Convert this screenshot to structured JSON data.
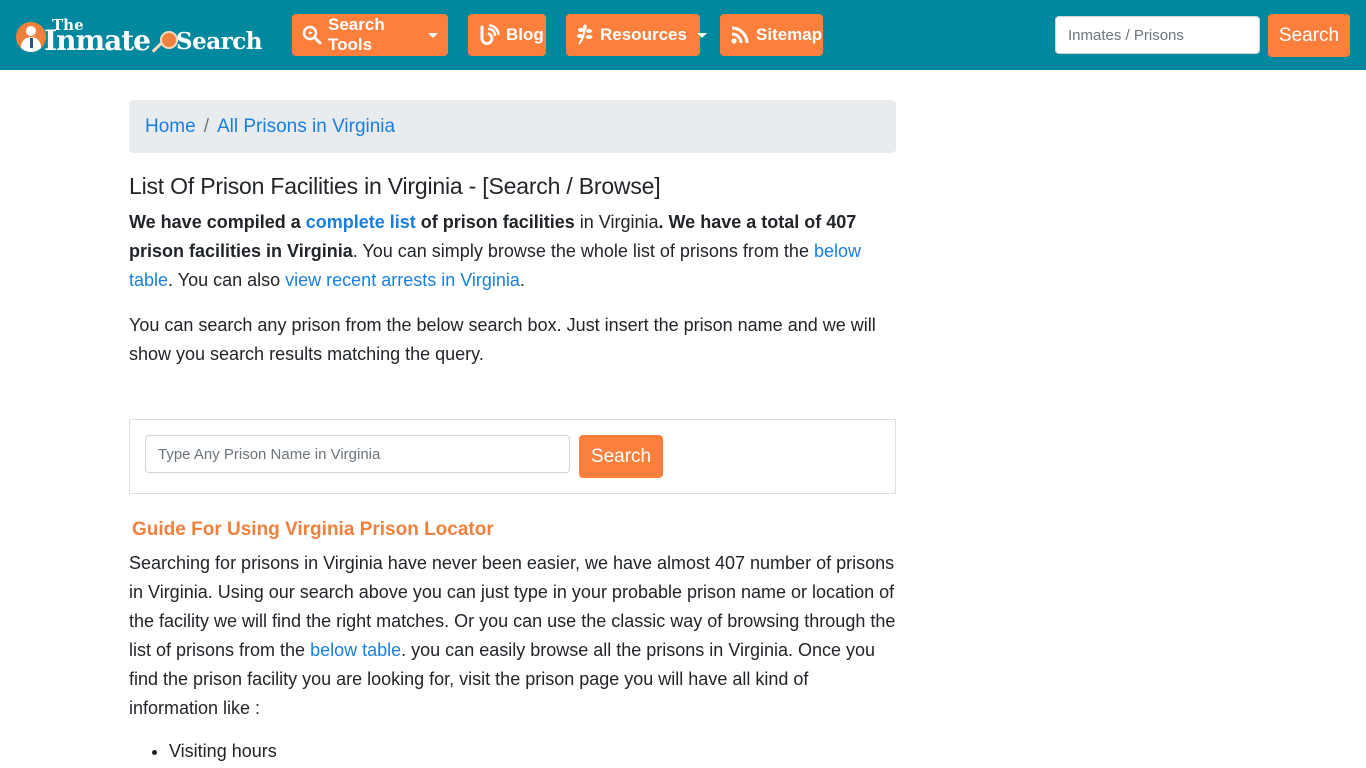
{
  "navbar": {
    "logo": {
      "the": "The",
      "inmate": "Inmate",
      "search": "Search"
    },
    "items": [
      {
        "label": "Search Tools",
        "icon": "search-bolt-icon",
        "dropdown": true
      },
      {
        "label": "Blog",
        "icon": "blogger-icon",
        "dropdown": false
      },
      {
        "label": "Resources",
        "icon": "leaf-icon",
        "dropdown": true
      },
      {
        "label": "Sitemap",
        "icon": "rss-icon",
        "dropdown": false
      }
    ],
    "search": {
      "placeholder": "Inmates / Prisons",
      "value": "",
      "button_label": "Search"
    }
  },
  "breadcrumb": {
    "items": [
      {
        "label": "Home"
      },
      {
        "label": "All Prisons in Virginia"
      }
    ],
    "separator": "/"
  },
  "main": {
    "title": "List Of Prison Facilities in Virginia - [Search / Browse]",
    "intro": {
      "p1": "We have compiled a ",
      "link_complete_list": "complete list",
      "p2": " of prison facilities",
      "p3": " in Virginia",
      "p4": ". We have a total of 407 prison facilities in Virginia",
      "p5": ". You can simply browse the whole list of prisons from the ",
      "link_below_table": "below table",
      "p6": ". You can also ",
      "link_recent_arrests": "view recent arrests in Virginia",
      "p7": "."
    },
    "search_desc": "You can search any prison from the below search box. Just insert the prison name and we will show you search results matching the query.",
    "prison_search": {
      "placeholder": "Type Any Prison Name in Virginia",
      "value": "",
      "button_label": "Search"
    },
    "guide": {
      "title": "Guide For Using Virginia Prison Locator",
      "p1": "Searching for prisons in Virginia have never been easier, we have almost 407 number of prisons in Virginia. Using our search above you can just type in your probable prison name or location of the facility we will find the right matches. Or you can use the classic way of browsing through the list of prisons from the ",
      "link_below_table": "below table",
      "p2": ". you can easily browse all the prisons in Virginia. Once you find the prison facility you are looking for, visit the prison page you will have all kind of information like :"
    },
    "info_list": [
      "Visiting hours"
    ]
  },
  "colors": {
    "navbar_bg": "#00889e",
    "accent_orange": "#fd7f3c",
    "link_blue": "#1a7ee0",
    "breadcrumb_bg": "#e9ecef"
  }
}
